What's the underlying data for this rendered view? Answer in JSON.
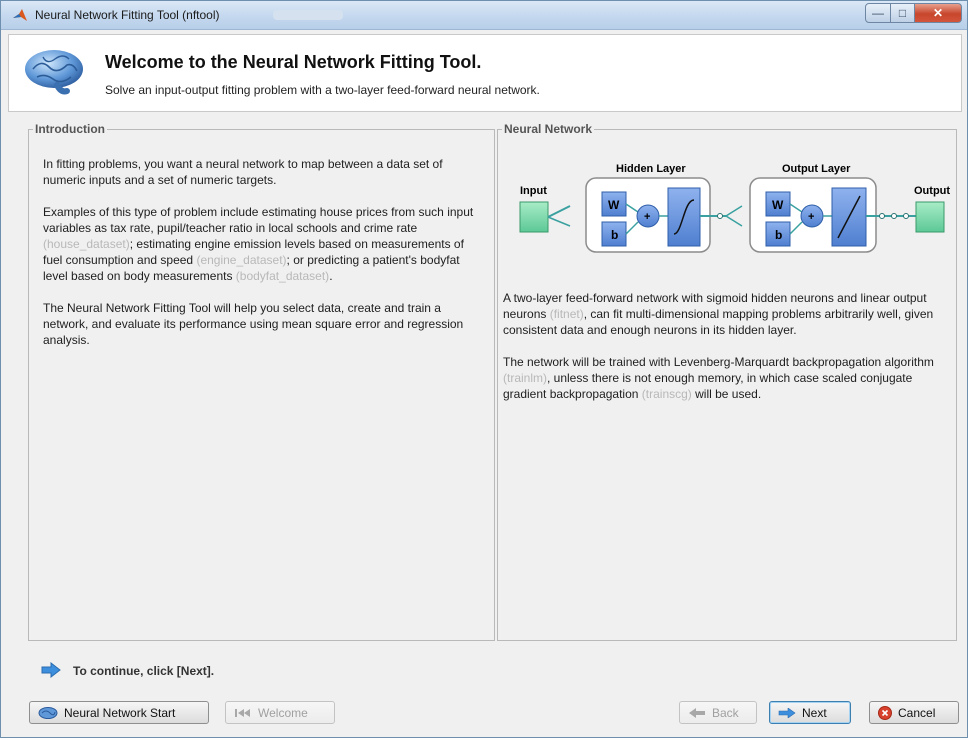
{
  "window": {
    "title": "Neural Network Fitting Tool (nftool)",
    "controls": {
      "minimize": "—",
      "maximize": "□",
      "close": "✕"
    }
  },
  "header": {
    "title": "Welcome to the Neural Network Fitting Tool.",
    "subtitle": "Solve an input-output fitting problem with a two-layer feed-forward neural network."
  },
  "introduction": {
    "legend": "Introduction",
    "p1": "In fitting problems, you want a neural network to map between a data set of numeric inputs and a set of numeric targets.",
    "p2_a": "Examples of this type of problem include estimating house prices from such input variables as tax rate, pupil/teacher ratio in local schools and crime rate ",
    "p2_link1": "(house_dataset)",
    "p2_b": "; estimating engine emission levels based on measurements of fuel consumption and speed ",
    "p2_link2": "(engine_dataset)",
    "p2_c": "; or predicting a patient's bodyfat level based on body measurements ",
    "p2_link3": "(bodyfat_dataset)",
    "p2_d": ".",
    "p3": "The Neural Network Fitting Tool will help you select data, create and train a network, and evaluate its performance using mean square error and regression analysis."
  },
  "neural_network": {
    "legend": "Neural Network",
    "diagram": {
      "input": "Input",
      "hidden_layer": "Hidden Layer",
      "output_layer": "Output Layer",
      "output": "Output",
      "w": "W",
      "b": "b",
      "plus": "+"
    },
    "p1_a": "A two-layer feed-forward network with sigmoid hidden neurons and linear output neurons ",
    "p1_link": "(fitnet)",
    "p1_b": ", can fit multi-dimensional mapping problems arbitrarily well, given consistent data and enough neurons in its hidden layer.",
    "p2_a": "The network will be trained with Levenberg-Marquardt backpropagation algorithm ",
    "p2_link1": "(trainlm)",
    "p2_b": ", unless there is not enough memory, in which case scaled conjugate gradient backpropagation ",
    "p2_link2": "(trainscg)",
    "p2_c": " will be used."
  },
  "footer": {
    "continue_text": "To continue, click [Next].",
    "buttons": {
      "nn_start": "Neural Network Start",
      "welcome": "Welcome",
      "back": "Back",
      "next": "Next",
      "cancel": "Cancel"
    }
  },
  "colors": {
    "node_green": "#7fd8a8",
    "box_blue": "#6f98de",
    "accent_blue": "#3c7fb1"
  }
}
